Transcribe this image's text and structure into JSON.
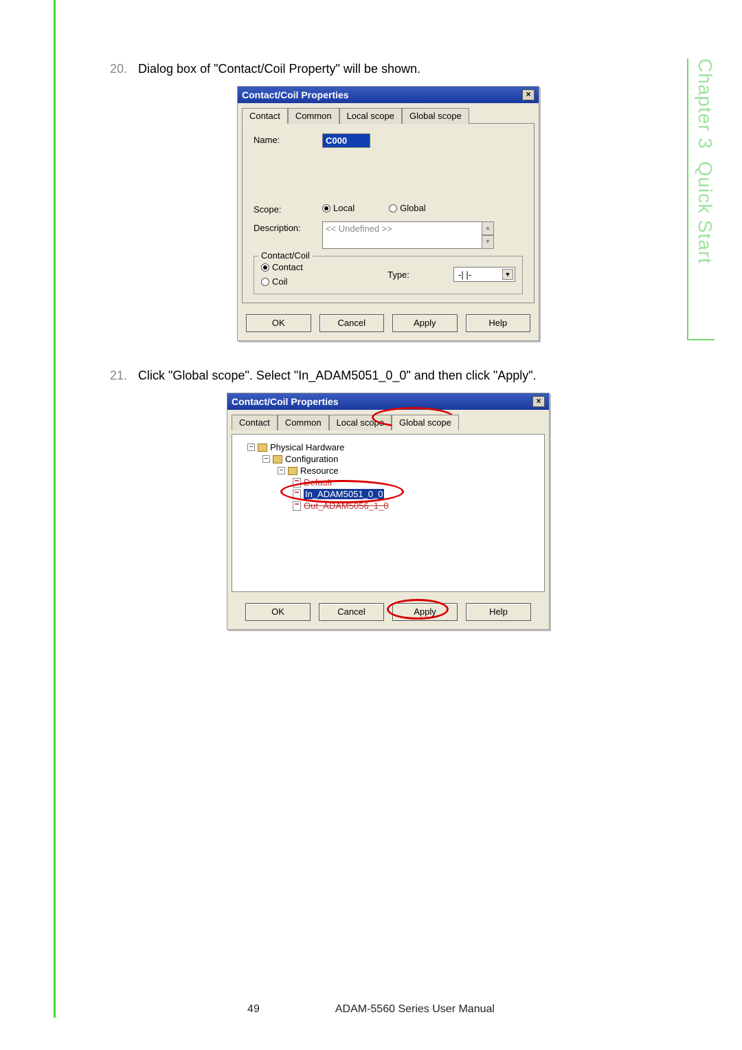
{
  "sidebar": {
    "chapter": "Chapter 3",
    "title": "Quick Start"
  },
  "steps": {
    "s20": {
      "num": "20.",
      "text": "Dialog box of \"Contact/Coil Property\" will be shown."
    },
    "s21": {
      "num": "21.",
      "text": "Click \"Global scope\". Select \"In_ADAM5051_0_0\" and then click \"Apply\"."
    }
  },
  "dlg1": {
    "title": "Contact/Coil Properties",
    "tabs": {
      "contact": "Contact",
      "common": "Common",
      "local": "Local scope",
      "global": "Global scope"
    },
    "labels": {
      "name": "Name:",
      "scope": "Scope:",
      "description": "Description:",
      "group": "Contact/Coil",
      "type": "Type:"
    },
    "nameValue": "C000",
    "scope": {
      "local": "Local",
      "global": "Global"
    },
    "descValue": "<< Undefined >>",
    "cc": {
      "contact": "Contact",
      "coil": "Coil"
    },
    "typeValue": "-| |-",
    "buttons": {
      "ok": "OK",
      "cancel": "Cancel",
      "apply": "Apply",
      "help": "Help"
    }
  },
  "dlg2": {
    "title": "Contact/Coil Properties",
    "tabs": {
      "contact": "Contact",
      "common": "Common",
      "local": "Local scope",
      "global": "Global scope"
    },
    "tree": {
      "root": "Physical Hardware",
      "n1": "Configuration",
      "n2": "Resource",
      "leaf1": "Default",
      "leaf2": "In_ADAM5051_0_0",
      "leaf3": "Out_ADAM5056_1_0"
    },
    "buttons": {
      "ok": "OK",
      "cancel": "Cancel",
      "apply": "Apply",
      "help": "Help"
    }
  },
  "footer": {
    "page": "49",
    "doc": "ADAM-5560 Series User Manual"
  }
}
